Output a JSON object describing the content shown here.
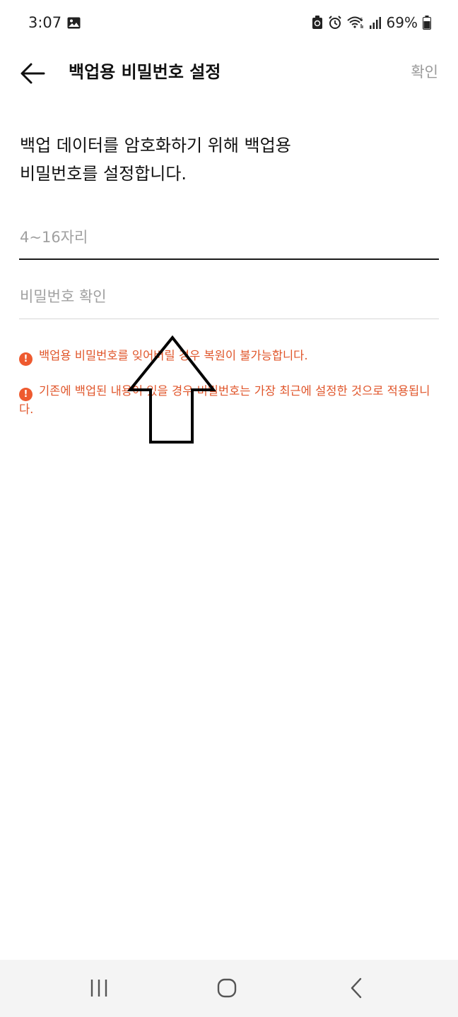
{
  "status_bar": {
    "time": "3:07",
    "battery": "69%",
    "icons": [
      "gallery-icon",
      "recycle-icon",
      "alarm-icon",
      "wifi-icon",
      "signal-icon",
      "battery-icon"
    ]
  },
  "header": {
    "title": "백업용 비밀번호 설정",
    "confirm_label": "확인",
    "back_icon": "arrow-left-icon"
  },
  "description": "백업 데이터를 암호화하기 위해 백업용\n비밀번호를 설정합니다.",
  "form": {
    "password_placeholder": "4~16자리",
    "password_value": "",
    "confirm_placeholder": "비밀번호 확인",
    "confirm_value": ""
  },
  "warnings": [
    "백업용 비밀번호를 잊어버릴 경우 복원이 불가능합니다.",
    "기존에 백업된 내용이 있을 경우 비밀번호는 가장 최근에 설정한 것으로 적용됩니다."
  ],
  "colors": {
    "warning": "#e0552a",
    "warning_icon": "#ee5a2f",
    "disabled_text": "#9a9a9a"
  },
  "nav_bar": {
    "icons": [
      "recent-apps-icon",
      "home-icon",
      "back-icon"
    ]
  }
}
